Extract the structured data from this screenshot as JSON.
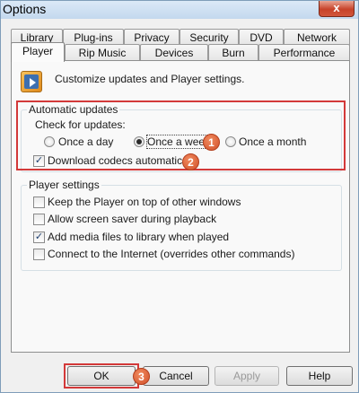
{
  "window": {
    "title": "Options",
    "close_glyph": "x"
  },
  "tabs_back": [
    {
      "label": "Library"
    },
    {
      "label": "Plug-ins"
    },
    {
      "label": "Privacy"
    },
    {
      "label": "Security"
    },
    {
      "label": "DVD"
    },
    {
      "label": "Network"
    }
  ],
  "tabs_front": [
    {
      "label": "Player",
      "active": true
    },
    {
      "label": "Rip Music"
    },
    {
      "label": "Devices"
    },
    {
      "label": "Burn"
    },
    {
      "label": "Performance"
    }
  ],
  "header": {
    "text": "Customize updates and Player settings.",
    "icon": "player-icon"
  },
  "updates": {
    "group_title": "Automatic updates",
    "check_label": "Check for updates:",
    "options": [
      {
        "label": "Once a day",
        "selected": false
      },
      {
        "label": "Once a week",
        "selected": true
      },
      {
        "label": "Once a month",
        "selected": false
      }
    ],
    "codecs_label": "Download codecs automatically",
    "codecs_checked": true
  },
  "player_settings": {
    "group_title": "Player settings",
    "items": [
      {
        "label": "Keep the Player on top of other windows",
        "checked": false
      },
      {
        "label": "Allow screen saver during playback",
        "checked": false
      },
      {
        "label": "Add media files to library when played",
        "checked": true
      },
      {
        "label": "Connect to the Internet (overrides other commands)",
        "checked": false
      }
    ]
  },
  "buttons": {
    "ok": "OK",
    "cancel": "Cancel",
    "apply": "Apply",
    "help": "Help"
  },
  "badges": [
    "1",
    "2",
    "3"
  ],
  "colors": {
    "highlight": "#d33939",
    "badge": "#d2512b"
  }
}
